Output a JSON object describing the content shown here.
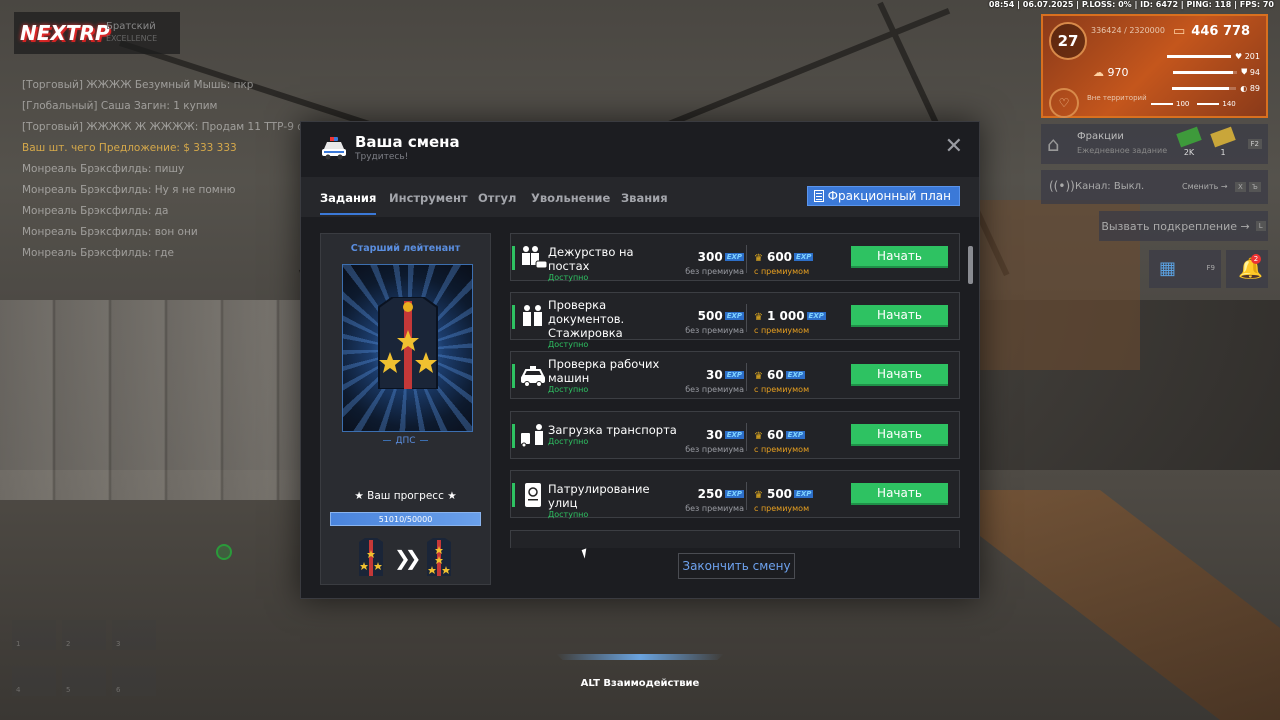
{
  "hud": {
    "logo": "NEXTRP",
    "server_name": "Братский",
    "server_sub": "EXCELLENCE",
    "status_line": "08:54 | 06.07.2025 | P.LOSS: 0% | ID: 6472 | PING: 118 | FPS: 70",
    "level": "27",
    "xp": "336424 / 2320000",
    "money": "446 778",
    "bank": "970",
    "health": "201",
    "armor": "94",
    "hunger": "89",
    "zone_label": "Вне территорий",
    "stat_a": "100",
    "stat_b": "140",
    "fraction_title": "Фракции",
    "fraction_sub": "Ежедневное задание",
    "cash_green": "2K",
    "cash_yellow": "1",
    "fraction_key": "F2",
    "channel_label": "Канал: Выкл.",
    "channel_switch": "Сменить →",
    "channel_key_x": "X",
    "channel_key_b": "Ъ",
    "support_label": "Вызвать подкрепление →",
    "support_key": "L",
    "calendar_key": "F9",
    "bell_badge": "2",
    "interact_text": "ALT Взаимодействие",
    "chat": [
      "[Торговый] ЖЖЖЖ Безумный Мышь: пкр",
      "[Глобальный] Саша Загин: 1 купим",
      "[Торговый] ЖЖЖЖ Ж ЖЖЖЖ: Продам 11 ТТР-9 от 4 дней",
      "Ваш шт. чего Предложение: $ 333 333",
      "Монреаль Брэксфилдь: пишу",
      "Монреаль Брэксфилдь: Ну я не помню",
      "Монреаль Брэксфилдь: да",
      "Монреаль Брэксфилдь: вон они",
      "Монреаль Брэксфилдь: где"
    ],
    "hotbar": [
      "1",
      "2",
      "3",
      "4",
      "5",
      "6"
    ]
  },
  "modal": {
    "title": "Ваша смена",
    "subtitle": "Трудитесь!",
    "tabs": [
      "Задания",
      "Инструмент",
      "Отгул",
      "Увольнение",
      "Звания"
    ],
    "plan_button": "Фракционный план",
    "rank_name": "Старший лейтенант",
    "department": "ДПС",
    "progress_label": "★ Ваш прогресс ★",
    "progress_text": "51010/50000",
    "progress_fraction": 1.0,
    "finish_button": "Закончить смену",
    "exp_tag": "EXP",
    "no_premium": "без премиума",
    "with_premium": "с премиумом",
    "start_label": "Начать",
    "status_available": "Доступно",
    "tasks": [
      {
        "name": "Дежурство на постах",
        "base": "300",
        "premium": "600",
        "icon": "officers-car-icon"
      },
      {
        "name": "Проверка документов. Стажировка",
        "base": "500",
        "premium": "1 000",
        "icon": "officers-icon"
      },
      {
        "name": "Проверка рабочих машин",
        "base": "30",
        "premium": "60",
        "icon": "police-car-icon"
      },
      {
        "name": "Загрузка транспорта",
        "base": "30",
        "premium": "60",
        "icon": "loader-icon"
      },
      {
        "name": "Патрулирование улиц",
        "base": "250",
        "premium": "500",
        "icon": "passport-icon"
      }
    ]
  },
  "colors": {
    "accent_blue": "#3b79d8",
    "start_green": "#2ec262",
    "modal_bg": "#1c1d21"
  }
}
